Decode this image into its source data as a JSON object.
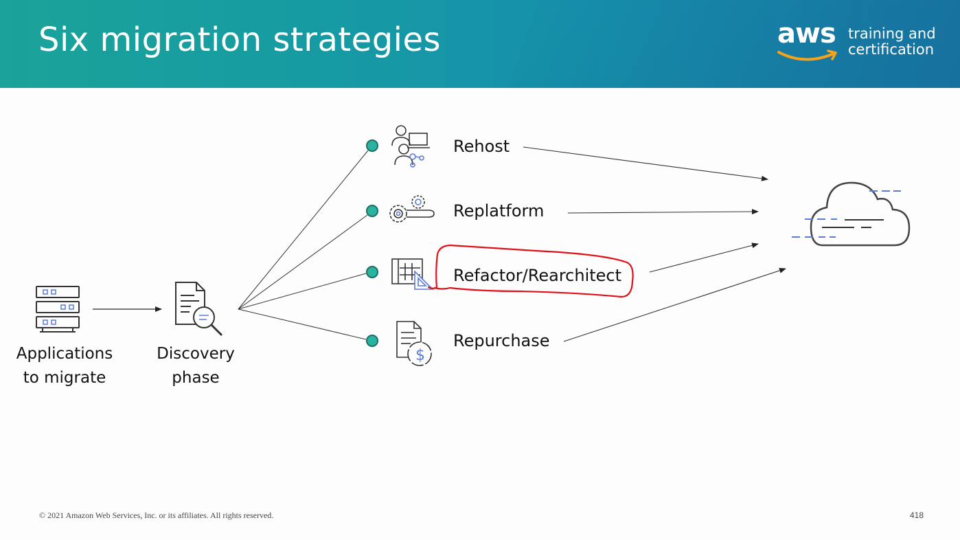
{
  "header": {
    "title": "Six migration strategies",
    "logo_word": "aws",
    "logo_line1": "training and",
    "logo_line2": "certification"
  },
  "nodes": {
    "applications_line1": "Applications",
    "applications_line2": "to migrate",
    "discovery_line1": "Discovery",
    "discovery_line2": "phase"
  },
  "strategies": [
    {
      "label": "Rehost",
      "icon": "people-computer-icon"
    },
    {
      "label": "Replatform",
      "icon": "gears-wrench-icon"
    },
    {
      "label": "Refactor/Rearchitect",
      "icon": "blueprint-icon"
    },
    {
      "label": "Repurchase",
      "icon": "document-dollar-icon"
    }
  ],
  "destination": {
    "icon": "cloud-icon"
  },
  "footer": {
    "copyright": "© 2021 Amazon Web Services, Inc. or its affiliates. All rights reserved.",
    "page_number": "418"
  },
  "colors": {
    "header_start": "#1aa39a",
    "header_end": "#1b7fae",
    "dot": "#2bb3a0",
    "annotation": "#e0101a",
    "aws_orange": "#f7a21b",
    "accent_blue": "#5b7bd6"
  }
}
